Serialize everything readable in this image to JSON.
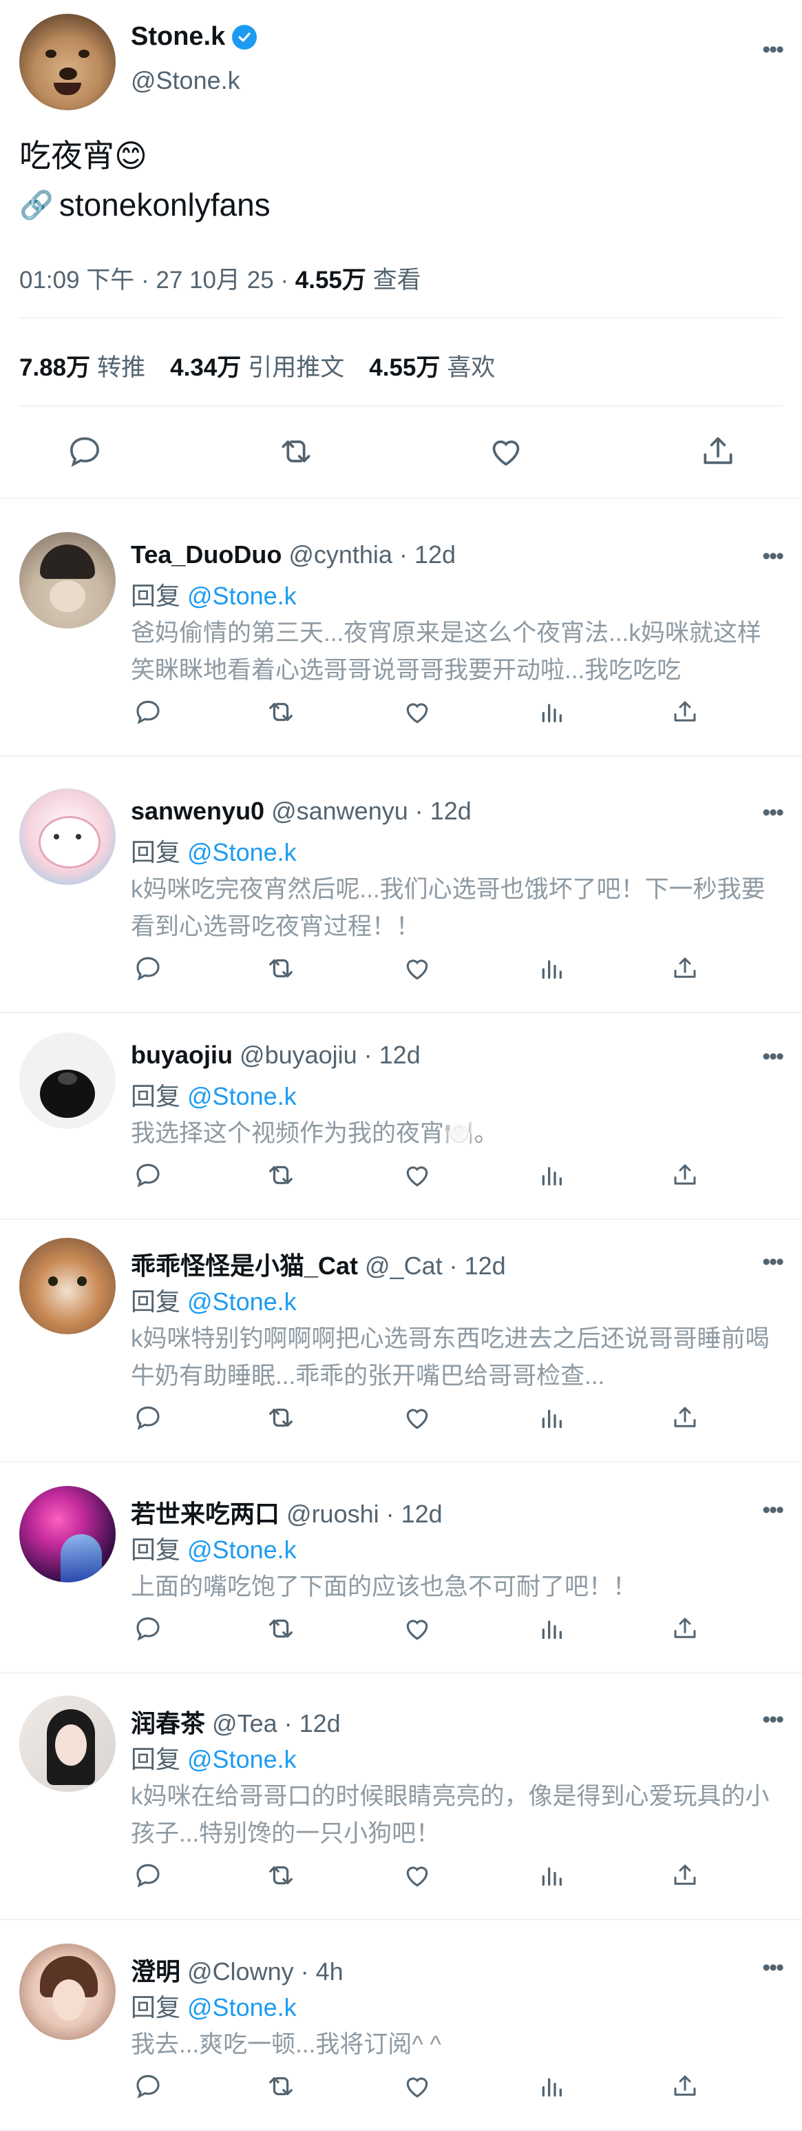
{
  "main_tweet": {
    "display_name": "Stone.k",
    "handle": "@Stone.k",
    "text": "吃夜宵😊",
    "link_icon": "🔗",
    "link_text": "stonekonlyfans",
    "time": "01:09 下午 · 27 10月 25 · ",
    "views_count": "4.55万",
    "views_label": " 查看",
    "stats": {
      "retweets_count": "7.88万",
      "retweets_label": "转推",
      "quotes_count": "4.34万",
      "quotes_label": "引用推文",
      "likes_count": "4.55万",
      "likes_label": "喜欢"
    },
    "more_label": "•••"
  },
  "replying_prefix": "回复 ",
  "replying_mention": "@Stone.k",
  "replies": [
    {
      "name": "Tea_DuoDuo",
      "meta": " @cynthia · 12d",
      "text": "爸妈偷情的第三天...夜宵原来是这么个夜宵法...k妈咪就这样笑眯眯地看着心选哥哥说哥哥我要开动啦...我吃吃吃",
      "avatar_color": "#c7b7a3"
    },
    {
      "name": "sanwenyu0",
      "meta": " @sanwenyu · 12d",
      "text": "k妈咪吃完夜宵然后呢...我们心选哥也饿坏了吧！下一秒我要看到心选哥吃夜宵过程！！",
      "avatar_color": "#f5d3dc"
    },
    {
      "name": "buyaojiu",
      "meta": " @buyaojiu · 12d",
      "text": "我选择这个视频作为我的夜宵🍽️。",
      "avatar_color": "#f2f2f2"
    },
    {
      "name": "乖乖怪怪是小猫_Cat",
      "meta": " @_Cat · 12d",
      "text": "k妈咪特别钓啊啊啊把心选哥东西吃进去之后还说哥哥睡前喝牛奶有助睡眠...乖乖的张开嘴巴给哥哥检查...",
      "avatar_color": "#c98a55"
    },
    {
      "name": "若世来吃两口",
      "meta": " @ruoshi · 12d",
      "text": "上面的嘴吃饱了下面的应该也急不可耐了吧！！",
      "avatar_color": "#3b0f4a"
    },
    {
      "name": "润春茶",
      "meta": " @Tea · 12d",
      "text": "k妈咪在给哥哥口的时候眼睛亮亮的，像是得到心爱玩具的小孩子...特别馋的一只小狗吧！",
      "avatar_color": "#d9d4cf"
    },
    {
      "name": "澄明",
      "meta": " @Clowny · 4h",
      "text": "我去...爽吃一顿...我将订阅^ ^",
      "avatar_color": "#e8c8b8"
    }
  ],
  "colors": {
    "accent": "#1d9bf0",
    "secondary_text": "#536471",
    "reply_text": "#8e9aa3",
    "divider": "#eff3f4"
  },
  "icons": [
    "verified-badge-icon",
    "link-icon",
    "reply-icon",
    "retweet-icon",
    "like-icon",
    "views-icon",
    "share-icon",
    "more-icon"
  ]
}
